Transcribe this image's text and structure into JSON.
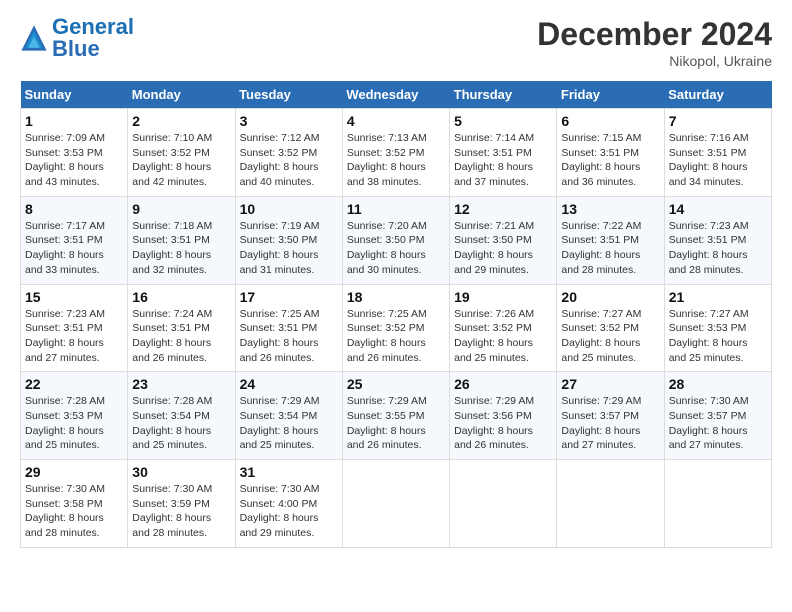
{
  "logo": {
    "text_general": "General",
    "text_blue": "Blue"
  },
  "header": {
    "month_title": "December 2024",
    "subtitle": "Nikopol, Ukraine"
  },
  "days_of_week": [
    "Sunday",
    "Monday",
    "Tuesday",
    "Wednesday",
    "Thursday",
    "Friday",
    "Saturday"
  ],
  "weeks": [
    [
      {
        "day": "1",
        "info": "Sunrise: 7:09 AM\nSunset: 3:53 PM\nDaylight: 8 hours\nand 43 minutes."
      },
      {
        "day": "2",
        "info": "Sunrise: 7:10 AM\nSunset: 3:52 PM\nDaylight: 8 hours\nand 42 minutes."
      },
      {
        "day": "3",
        "info": "Sunrise: 7:12 AM\nSunset: 3:52 PM\nDaylight: 8 hours\nand 40 minutes."
      },
      {
        "day": "4",
        "info": "Sunrise: 7:13 AM\nSunset: 3:52 PM\nDaylight: 8 hours\nand 38 minutes."
      },
      {
        "day": "5",
        "info": "Sunrise: 7:14 AM\nSunset: 3:51 PM\nDaylight: 8 hours\nand 37 minutes."
      },
      {
        "day": "6",
        "info": "Sunrise: 7:15 AM\nSunset: 3:51 PM\nDaylight: 8 hours\nand 36 minutes."
      },
      {
        "day": "7",
        "info": "Sunrise: 7:16 AM\nSunset: 3:51 PM\nDaylight: 8 hours\nand 34 minutes."
      }
    ],
    [
      {
        "day": "8",
        "info": "Sunrise: 7:17 AM\nSunset: 3:51 PM\nDaylight: 8 hours\nand 33 minutes."
      },
      {
        "day": "9",
        "info": "Sunrise: 7:18 AM\nSunset: 3:51 PM\nDaylight: 8 hours\nand 32 minutes."
      },
      {
        "day": "10",
        "info": "Sunrise: 7:19 AM\nSunset: 3:50 PM\nDaylight: 8 hours\nand 31 minutes."
      },
      {
        "day": "11",
        "info": "Sunrise: 7:20 AM\nSunset: 3:50 PM\nDaylight: 8 hours\nand 30 minutes."
      },
      {
        "day": "12",
        "info": "Sunrise: 7:21 AM\nSunset: 3:50 PM\nDaylight: 8 hours\nand 29 minutes."
      },
      {
        "day": "13",
        "info": "Sunrise: 7:22 AM\nSunset: 3:51 PM\nDaylight: 8 hours\nand 28 minutes."
      },
      {
        "day": "14",
        "info": "Sunrise: 7:23 AM\nSunset: 3:51 PM\nDaylight: 8 hours\nand 28 minutes."
      }
    ],
    [
      {
        "day": "15",
        "info": "Sunrise: 7:23 AM\nSunset: 3:51 PM\nDaylight: 8 hours\nand 27 minutes."
      },
      {
        "day": "16",
        "info": "Sunrise: 7:24 AM\nSunset: 3:51 PM\nDaylight: 8 hours\nand 26 minutes."
      },
      {
        "day": "17",
        "info": "Sunrise: 7:25 AM\nSunset: 3:51 PM\nDaylight: 8 hours\nand 26 minutes."
      },
      {
        "day": "18",
        "info": "Sunrise: 7:25 AM\nSunset: 3:52 PM\nDaylight: 8 hours\nand 26 minutes."
      },
      {
        "day": "19",
        "info": "Sunrise: 7:26 AM\nSunset: 3:52 PM\nDaylight: 8 hours\nand 25 minutes."
      },
      {
        "day": "20",
        "info": "Sunrise: 7:27 AM\nSunset: 3:52 PM\nDaylight: 8 hours\nand 25 minutes."
      },
      {
        "day": "21",
        "info": "Sunrise: 7:27 AM\nSunset: 3:53 PM\nDaylight: 8 hours\nand 25 minutes."
      }
    ],
    [
      {
        "day": "22",
        "info": "Sunrise: 7:28 AM\nSunset: 3:53 PM\nDaylight: 8 hours\nand 25 minutes."
      },
      {
        "day": "23",
        "info": "Sunrise: 7:28 AM\nSunset: 3:54 PM\nDaylight: 8 hours\nand 25 minutes."
      },
      {
        "day": "24",
        "info": "Sunrise: 7:29 AM\nSunset: 3:54 PM\nDaylight: 8 hours\nand 25 minutes."
      },
      {
        "day": "25",
        "info": "Sunrise: 7:29 AM\nSunset: 3:55 PM\nDaylight: 8 hours\nand 26 minutes."
      },
      {
        "day": "26",
        "info": "Sunrise: 7:29 AM\nSunset: 3:56 PM\nDaylight: 8 hours\nand 26 minutes."
      },
      {
        "day": "27",
        "info": "Sunrise: 7:29 AM\nSunset: 3:57 PM\nDaylight: 8 hours\nand 27 minutes."
      },
      {
        "day": "28",
        "info": "Sunrise: 7:30 AM\nSunset: 3:57 PM\nDaylight: 8 hours\nand 27 minutes."
      }
    ],
    [
      {
        "day": "29",
        "info": "Sunrise: 7:30 AM\nSunset: 3:58 PM\nDaylight: 8 hours\nand 28 minutes."
      },
      {
        "day": "30",
        "info": "Sunrise: 7:30 AM\nSunset: 3:59 PM\nDaylight: 8 hours\nand 28 minutes."
      },
      {
        "day": "31",
        "info": "Sunrise: 7:30 AM\nSunset: 4:00 PM\nDaylight: 8 hours\nand 29 minutes."
      },
      {
        "day": "",
        "info": ""
      },
      {
        "day": "",
        "info": ""
      },
      {
        "day": "",
        "info": ""
      },
      {
        "day": "",
        "info": ""
      }
    ]
  ]
}
